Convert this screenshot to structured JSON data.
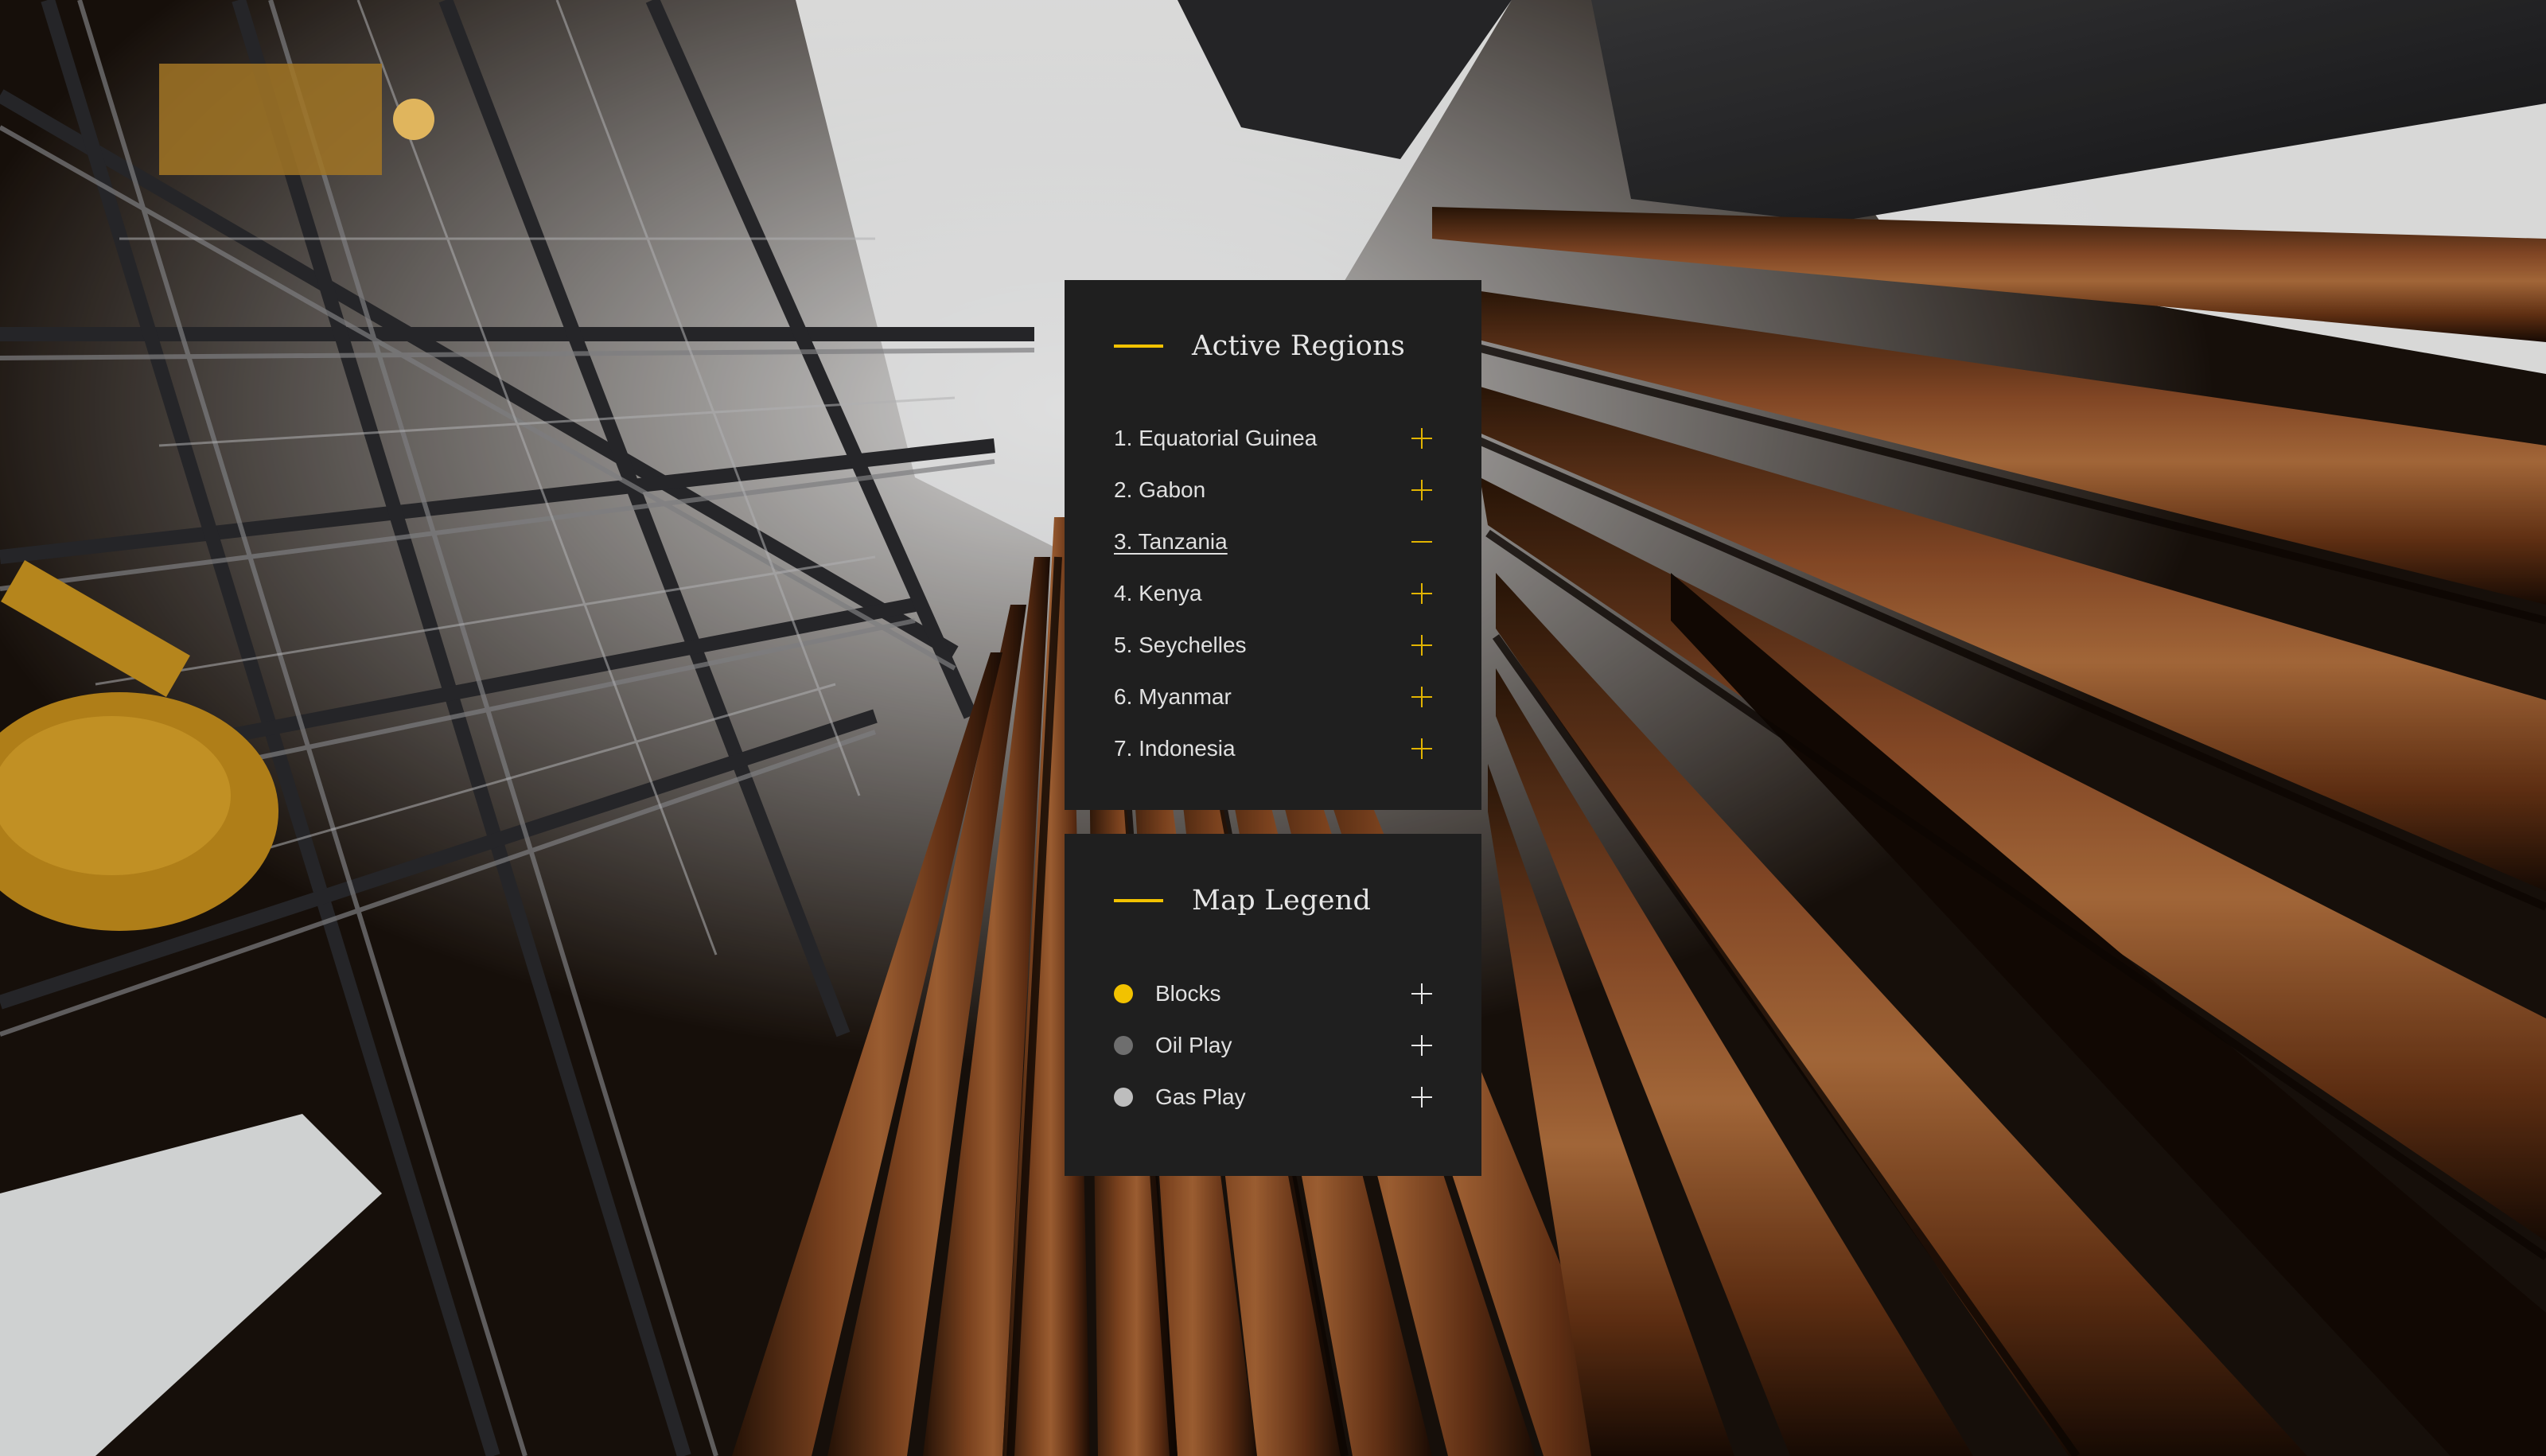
{
  "regions_panel": {
    "title": "Active Regions",
    "items": [
      {
        "label": "1. Equatorial Guinea",
        "state": "collapsed",
        "icon": "plus-icon"
      },
      {
        "label": "2. Gabon",
        "state": "collapsed",
        "icon": "plus-icon"
      },
      {
        "label": "3. Tanzania",
        "state": "expanded",
        "icon": "minus-icon"
      },
      {
        "label": "4. Kenya",
        "state": "collapsed",
        "icon": "plus-icon"
      },
      {
        "label": "5. Seychelles",
        "state": "collapsed",
        "icon": "plus-icon"
      },
      {
        "label": "6. Myanmar",
        "state": "collapsed",
        "icon": "plus-icon"
      },
      {
        "label": "7. Indonesia",
        "state": "collapsed",
        "icon": "plus-icon"
      }
    ]
  },
  "legend_panel": {
    "title": "Map Legend",
    "items": [
      {
        "label": "Blocks",
        "color": "#f2c200",
        "icon": "plus-icon"
      },
      {
        "label": "Oil Play",
        "color": "#6e6e6e",
        "icon": "plus-icon"
      },
      {
        "label": "Gas Play",
        "color": "#bdbdbd",
        "icon": "plus-icon"
      }
    ]
  },
  "colors": {
    "accent": "#f2c200",
    "panel_bg": "#1f1f1f",
    "text": "#e6e6e6"
  }
}
